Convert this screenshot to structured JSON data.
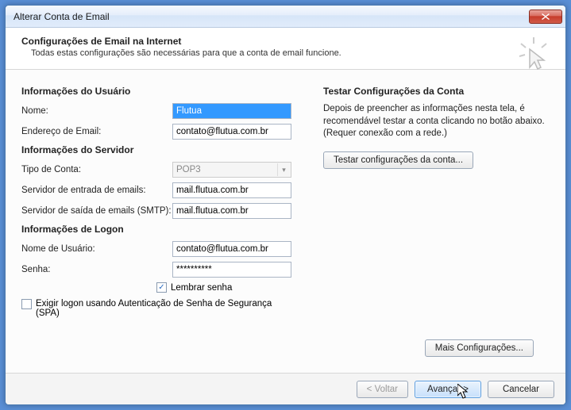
{
  "window": {
    "title": "Alterar Conta de Email"
  },
  "header": {
    "title": "Configurações de Email na Internet",
    "desc": "Todas estas configurações são necessárias para que a conta de email funcione."
  },
  "sections": {
    "user_info": "Informações do Usuário",
    "server_info": "Informações do Servidor",
    "logon_info": "Informações de Logon",
    "test_title": "Testar Configurações da Conta"
  },
  "labels": {
    "name": "Nome:",
    "email": "Endereço de Email:",
    "account_type": "Tipo de Conta:",
    "incoming": "Servidor de entrada de emails:",
    "outgoing": "Servidor de saída de emails (SMTP):",
    "username": "Nome de Usuário:",
    "password": "Senha:",
    "remember": "Lembrar senha",
    "spa": "Exigir logon usando Autenticação de Senha de Segurança (SPA)"
  },
  "values": {
    "name": "Flutua",
    "email": "contato@flutua.com.br",
    "account_type": "POP3",
    "incoming": "mail.flutua.com.br",
    "outgoing": "mail.flutua.com.br",
    "username": "contato@flutua.com.br",
    "password": "**********",
    "remember_checked": "✓",
    "spa_checked": ""
  },
  "right": {
    "desc": "Depois de preencher as informações nesta tela, é recomendável testar a conta clicando no botão abaixo. (Requer conexão com a rede.)",
    "test_btn": "Testar configurações da conta...",
    "more_btn": "Mais Configurações..."
  },
  "footer": {
    "back": "< Voltar",
    "next": "Avançar >",
    "cancel": "Cancelar"
  }
}
